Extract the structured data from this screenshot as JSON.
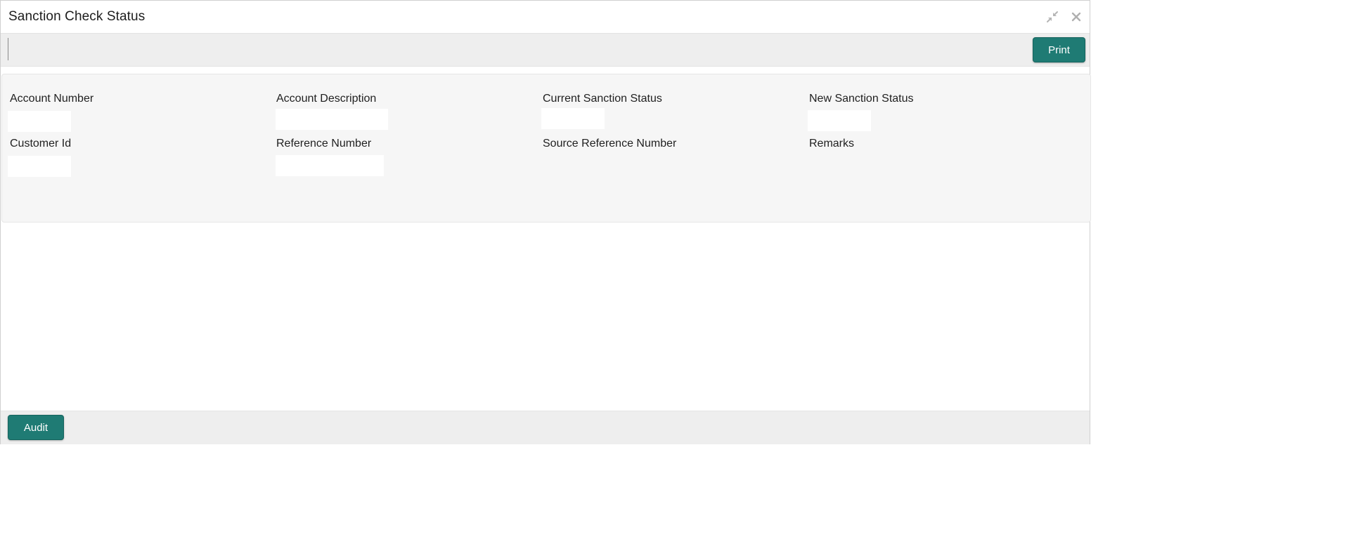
{
  "window": {
    "title": "Sanction Check Status"
  },
  "controls": {
    "minimize_icon": "compress-arrows-icon",
    "close_icon": "close-icon"
  },
  "toolbar": {
    "print_label": "Print"
  },
  "form": {
    "account_number": {
      "label": "Account Number",
      "value": ""
    },
    "account_description": {
      "label": "Account Description",
      "value": ""
    },
    "current_sanction_status": {
      "label": "Current Sanction Status",
      "value": ""
    },
    "new_sanction_status": {
      "label": "New Sanction Status",
      "value": ""
    },
    "customer_id": {
      "label": "Customer Id",
      "value": ""
    },
    "reference_number": {
      "label": "Reference Number",
      "value": ""
    },
    "source_reference_number": {
      "label": "Source Reference Number"
    },
    "remarks": {
      "label": "Remarks"
    }
  },
  "footer": {
    "audit_label": "Audit"
  },
  "colors": {
    "accent": "#1f7b74",
    "panel_bg": "#f6f6f6",
    "bar_bg": "#eeeeee"
  }
}
